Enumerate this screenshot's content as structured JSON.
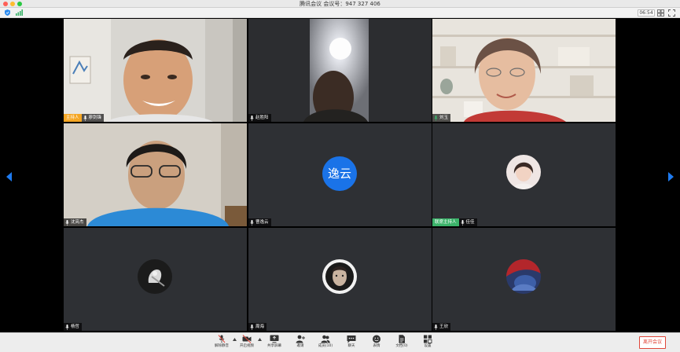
{
  "window": {
    "title": "腾讯会议 会议号：947 327 406"
  },
  "status": {
    "time": "06:54"
  },
  "tiles": [
    {
      "name": "廖剑锋",
      "role": "主持人",
      "type": "video"
    },
    {
      "name": "赵胜阳",
      "role": "",
      "type": "video"
    },
    {
      "name": "刘玉",
      "role": "",
      "type": "video"
    },
    {
      "name": "沈亮杰",
      "role": "",
      "type": "video"
    },
    {
      "name": "曹逸云",
      "role": "",
      "type": "avatar",
      "avatar_text": "逸云"
    },
    {
      "name": "佳佳",
      "role": "联席主持人",
      "type": "avatar"
    },
    {
      "name": "杨哲",
      "role": "",
      "type": "avatar"
    },
    {
      "name": "周海",
      "role": "",
      "type": "avatar"
    },
    {
      "name": "王欣",
      "role": "",
      "type": "avatar"
    }
  ],
  "toolbar": {
    "items": [
      {
        "label": "解除静音",
        "icon": "mic-muted-icon"
      },
      {
        "label": "开启视频",
        "icon": "video-off-icon"
      },
      {
        "label": "共享屏幕",
        "icon": "share-screen-icon"
      },
      {
        "label": "邀请",
        "icon": "invite-icon"
      },
      {
        "label": "成员(10)",
        "icon": "members-icon"
      },
      {
        "label": "聊天",
        "icon": "chat-icon"
      },
      {
        "label": "表情",
        "icon": "emoji-icon"
      },
      {
        "label": "文档(0)",
        "icon": "document-icon"
      },
      {
        "label": "设置",
        "icon": "settings-icon"
      }
    ],
    "leave_label": "离开会议"
  },
  "colors": {
    "host_tag": "#f5a623",
    "cohost_tag": "#3bb36a",
    "leave": "#e0463a",
    "avatar_blue": "#1a73e8"
  }
}
